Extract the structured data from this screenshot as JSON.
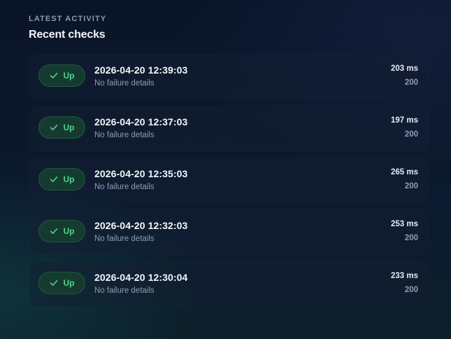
{
  "header": {
    "eyebrow": "LATEST ACTIVITY",
    "title": "Recent checks"
  },
  "checks": [
    {
      "status": "Up",
      "status_icon": "check-icon",
      "time": "2026-04-20 12:39:03",
      "detail": "No failure details",
      "latency": "203 ms",
      "code": "200"
    },
    {
      "status": "Up",
      "status_icon": "check-icon",
      "time": "2026-04-20 12:37:03",
      "detail": "No failure details",
      "latency": "197 ms",
      "code": "200"
    },
    {
      "status": "Up",
      "status_icon": "check-icon",
      "time": "2026-04-20 12:35:03",
      "detail": "No failure details",
      "latency": "265 ms",
      "code": "200"
    },
    {
      "status": "Up",
      "status_icon": "check-icon",
      "time": "2026-04-20 12:32:03",
      "detail": "No failure details",
      "latency": "253 ms",
      "code": "200"
    },
    {
      "status": "Up",
      "status_icon": "check-icon",
      "time": "2026-04-20 12:30:04",
      "detail": "No failure details",
      "latency": "233 ms",
      "code": "200"
    }
  ],
  "colors": {
    "up_green": "#4fd38a",
    "pill_bg": "#153b30",
    "background": "#0a1428"
  }
}
